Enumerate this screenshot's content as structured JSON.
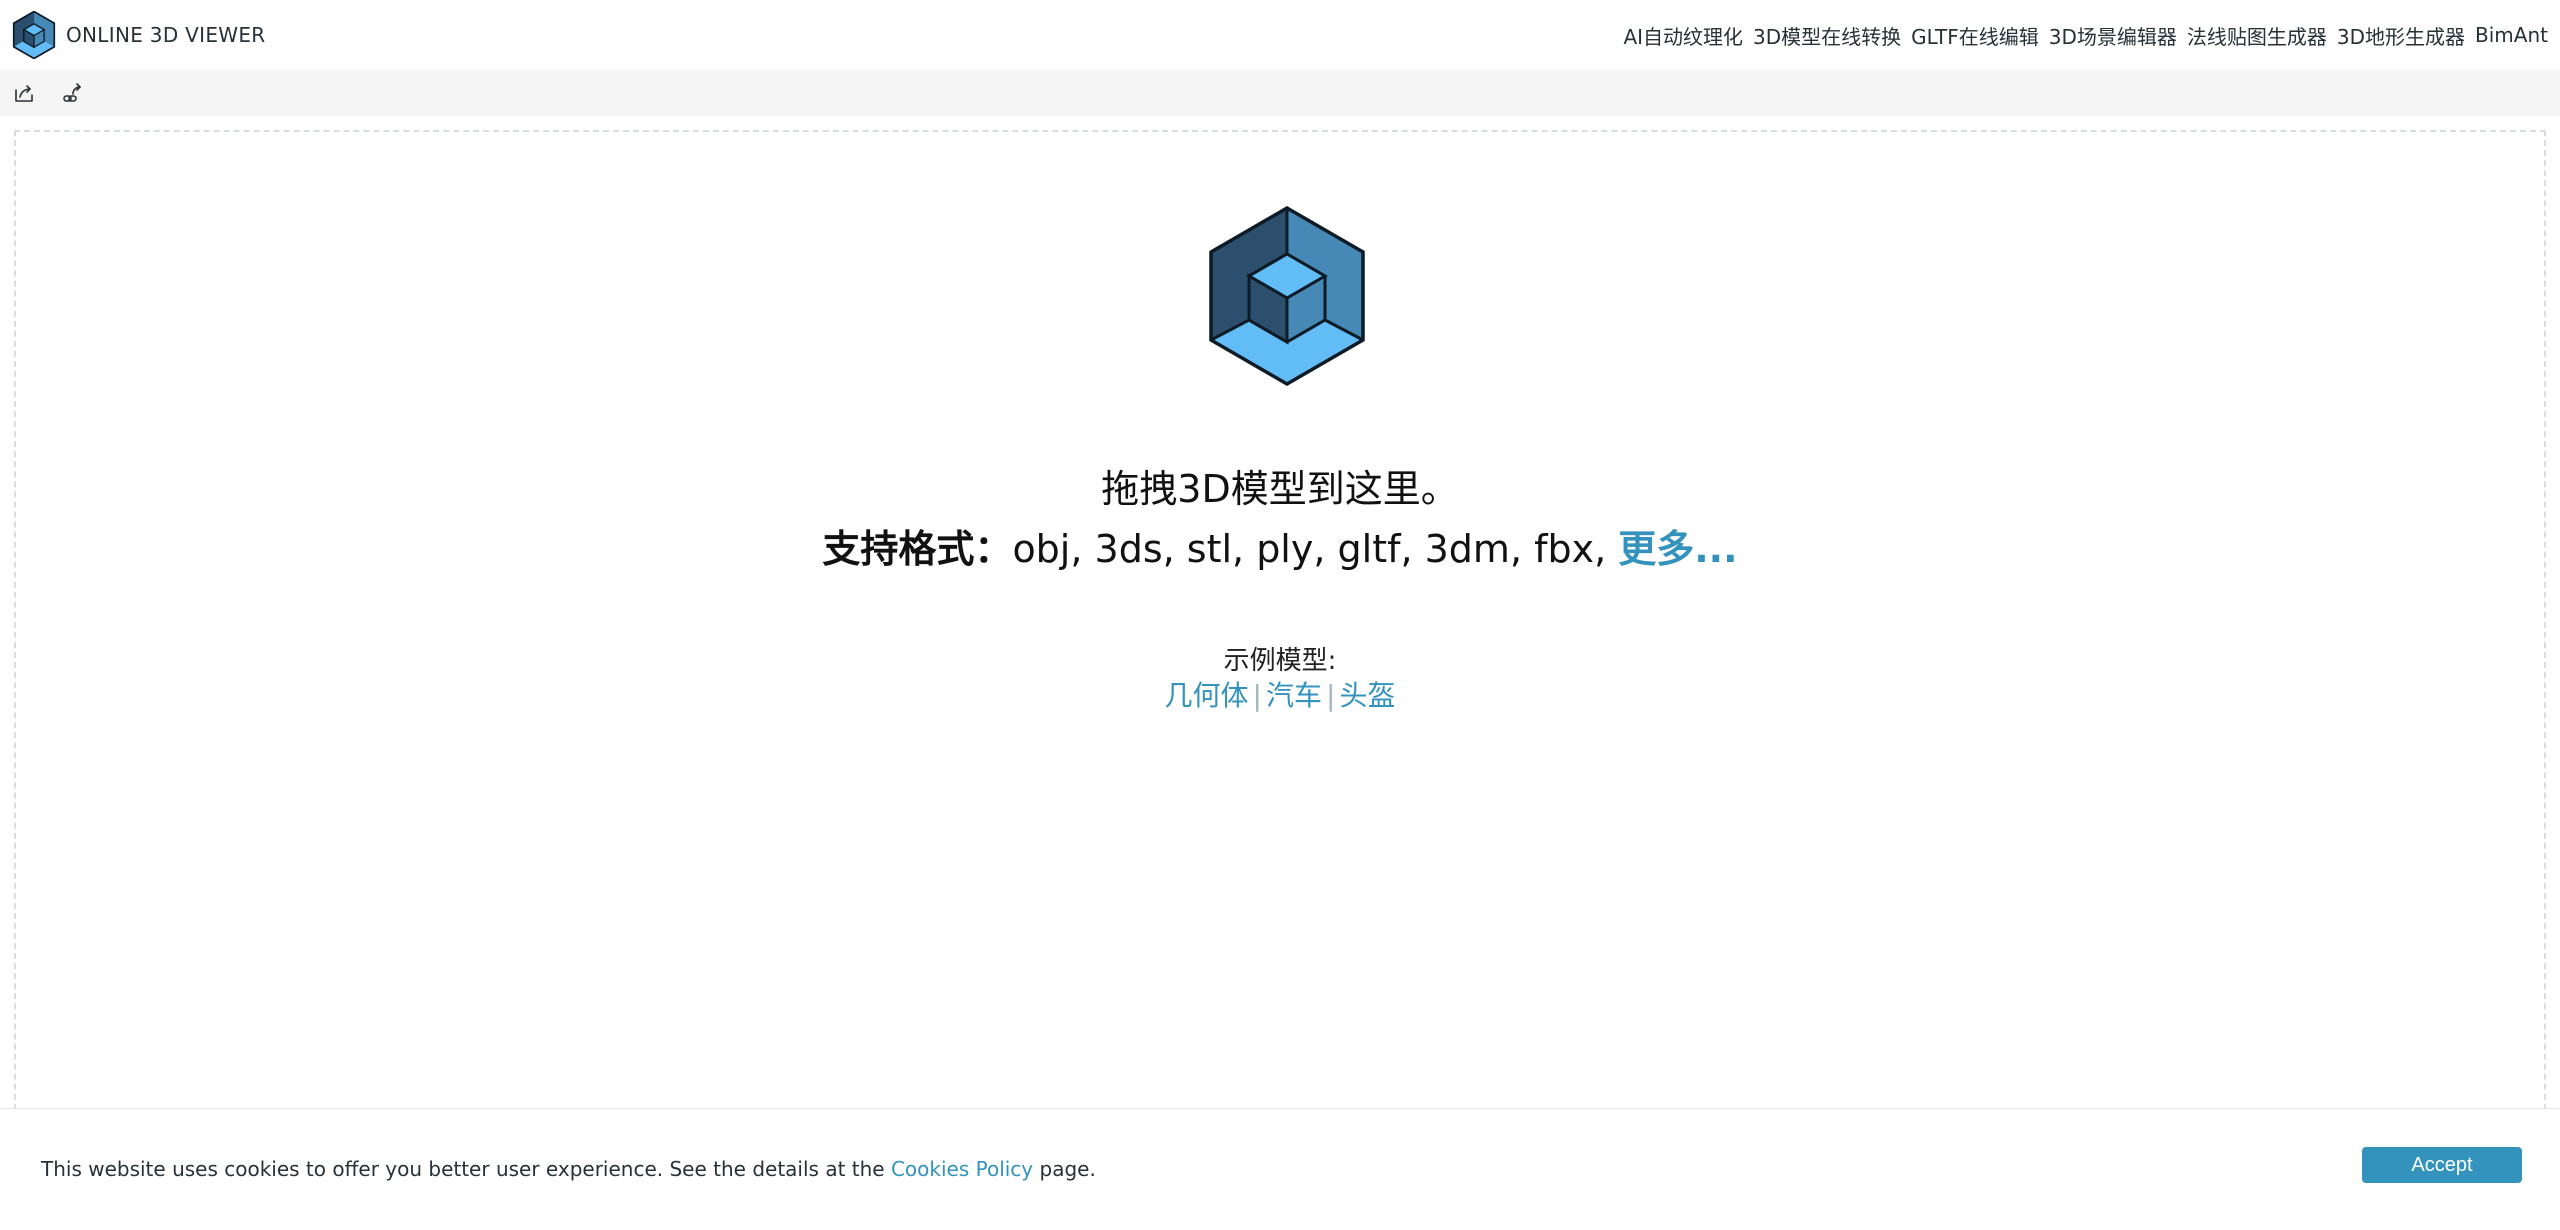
{
  "header": {
    "brand_title": "ONLINE 3D VIEWER",
    "nav_links": [
      "AI自动纹理化",
      "3D模型在线转换",
      "GLTF在线编辑",
      "3D场景编辑器",
      "法线贴图生成器",
      "3D地形生成器",
      "BimAnt"
    ]
  },
  "toolbar": {
    "icons": [
      "open-file-icon",
      "open-url-icon"
    ]
  },
  "main": {
    "drop_text": "拖拽3D模型到这里。",
    "formats_label": "支持格式：",
    "formats_list": "obj, 3ds, stl, ply, gltf, 3dm, fbx, ",
    "formats_more": "更多...",
    "examples_title": "示例模型:",
    "examples": [
      "几何体",
      "汽车",
      "头盔"
    ],
    "separator": "|"
  },
  "cookie": {
    "text_before": "This website uses cookies to offer you better user experience. See the details at the ",
    "link": "Cookies Policy",
    "text_after": " page.",
    "accept_label": "Accept"
  },
  "colors": {
    "accent": "#3393bd",
    "toolbar_bg": "#f5f5f5",
    "logo_dark": "#2c4f6e",
    "logo_mid": "#4789b6",
    "logo_light": "#62bdf6"
  }
}
